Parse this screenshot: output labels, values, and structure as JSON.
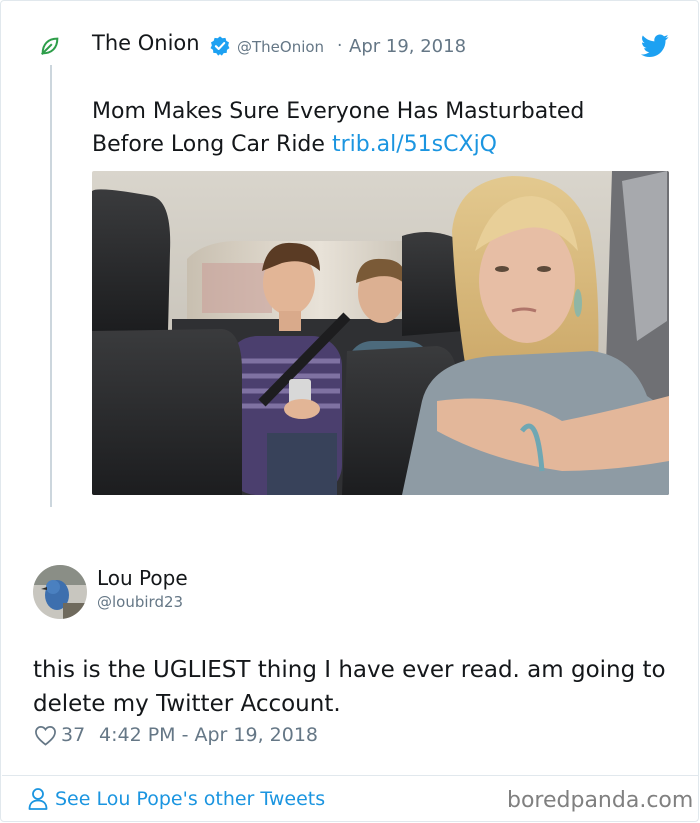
{
  "quoted_tweet": {
    "author_name": "The Onion",
    "verified_icon": "verified-badge-icon",
    "handle": "@TheOnion",
    "separator": "·",
    "date": "Apr 19, 2018",
    "text": "Mom Makes Sure Everyone Has Masturbated Before Long Car Ride ",
    "link": "trib.al/51sCXjQ",
    "logo_icon": "onion-leaf-icon",
    "platform_icon": "twitter-bird-icon",
    "link_color": "#1b95e0",
    "brand_color": "#1da1f2"
  },
  "reply_tweet": {
    "author_name": "Lou Pope",
    "handle": "@loubird23",
    "text": "this is the UGLIEST thing I have ever read. am going to delete my Twitter Account.",
    "like_icon": "heart-outline-icon",
    "likes": "37",
    "timestamp": "4:42 PM - Apr 19, 2018"
  },
  "footer": {
    "see_more_label": "See Lou Pope's other Tweets",
    "see_more_icon": "person-outline-icon",
    "watermark": "boredpanda.com"
  }
}
